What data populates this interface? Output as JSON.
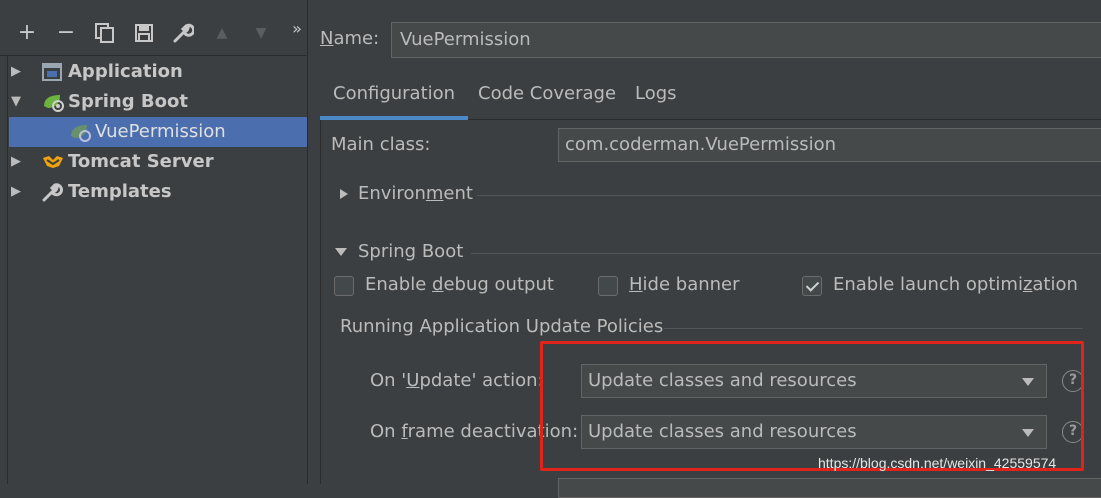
{
  "toolbar": {
    "buttons": [
      "add-icon",
      "remove-icon",
      "copy-icon",
      "save-icon",
      "wrench-icon",
      "move-up-icon",
      "move-down-icon",
      "more-icon"
    ],
    "glyphs": [
      "+",
      "−",
      "⧉",
      "🖫",
      "🔧",
      "▲",
      "▼",
      "»"
    ]
  },
  "tree": {
    "items": [
      {
        "label": "Application",
        "icon": "application-icon",
        "bold": true,
        "expanded": false
      },
      {
        "label": "Spring Boot",
        "icon": "spring-boot-icon",
        "bold": true,
        "expanded": true
      },
      {
        "label": "VuePermission",
        "icon": "spring-config-icon",
        "bold": false,
        "selected": true
      },
      {
        "label": "Tomcat Server",
        "icon": "tomcat-icon",
        "bold": true,
        "expanded": false
      },
      {
        "label": "Templates",
        "icon": "wrench-icon",
        "bold": true,
        "expanded": false
      }
    ]
  },
  "name": {
    "label_u": "N",
    "label_rest": "ame:",
    "value": "VuePermission"
  },
  "tabs": [
    "Configuration",
    "Code Coverage",
    "Logs"
  ],
  "main_class": {
    "label": "Main class:",
    "value": "com.coderman.VuePermission"
  },
  "environment": {
    "pre": "Environ",
    "u": "m",
    "post": "ent"
  },
  "spring_boot": {
    "pre": "Sprin",
    "u": "g",
    "post": " Boot",
    "checkboxes": [
      {
        "pre": "Enable ",
        "u": "d",
        "post": "ebug output",
        "checked": false
      },
      {
        "pre": "",
        "u": "H",
        "post": "ide banner",
        "checked": false
      },
      {
        "pre": "Enable launch optimi",
        "u": "z",
        "post": "ation",
        "checked": true
      }
    ]
  },
  "policies": {
    "title": "Running Application Update Policies",
    "update_action": {
      "pre": "On '",
      "u": "U",
      "post": "pdate' action:",
      "value": "Update classes and resources"
    },
    "frame_deactivation": {
      "pre": "On ",
      "u": "f",
      "post": "rame deactivation:",
      "value": "Update classes and resources"
    }
  },
  "help_glyph": "?",
  "watermark": "https://blog.csdn.net/weixin_42559574",
  "colors": {
    "background": "#3c3f41",
    "selection": "#4b6eaf",
    "accent": "#4a88c7",
    "highlight_box": "#e0241b"
  }
}
